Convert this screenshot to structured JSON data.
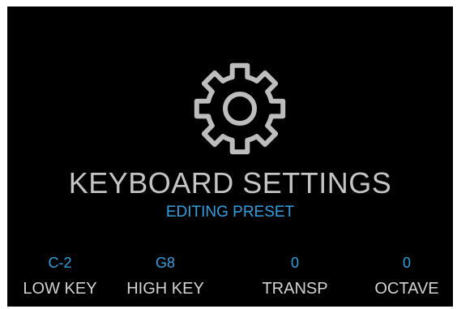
{
  "screen": {
    "title": "KEYBOARD SETTINGS",
    "subtitle": "EDITING PRESET",
    "icon": "gear-icon"
  },
  "params": [
    {
      "value": "C-2",
      "label": "LOW KEY"
    },
    {
      "value": "G8",
      "label": "HIGH KEY"
    },
    {
      "value": "0",
      "label": "TRANSP"
    },
    {
      "value": "0",
      "label": "OCTAVE"
    }
  ],
  "colors": {
    "background": "#000000",
    "title": "#c4c4c4",
    "accent": "#2f9fe0",
    "label": "#d2d2d2"
  }
}
